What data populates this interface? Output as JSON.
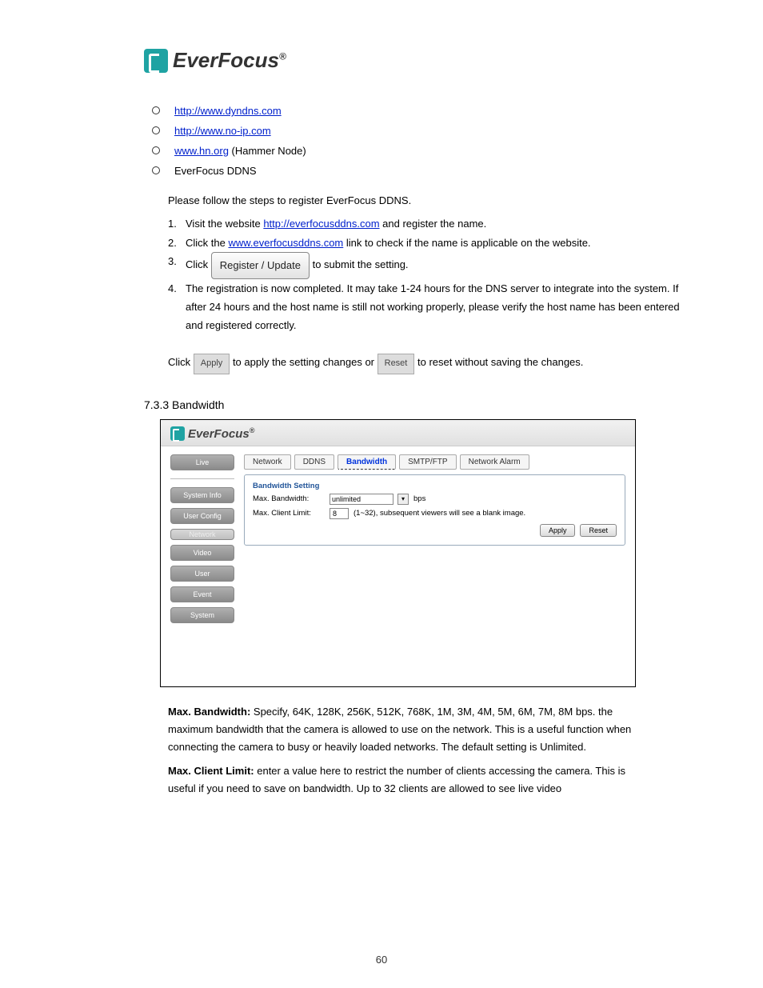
{
  "logo": {
    "brand": "EverFocus",
    "reg": "®"
  },
  "bullets": [
    {
      "link": "http://www.dyndns.com",
      "tail": " "
    },
    {
      "link": "http://www.no-ip.com",
      "tail": " "
    },
    {
      "link": "www.hn.org",
      "tail": " (Hammer Node)"
    },
    {
      "link": "",
      "tail": "EverFocus DDNS"
    }
  ],
  "instr": {
    "title": "Please follow the steps to register EverFocus DDNS.",
    "s1_n": "1.",
    "s1_txt_a": "Visit the website ",
    "s1_link": "http://everfocusddns.com",
    "s1_txt_b": " and register the name.",
    "s2_n": "2.",
    "s2_txt_a": "Click the ",
    "s2_link": "www.everfocusddns.com",
    "s2_txt_b": " link to check if the name is applicable on the website.",
    "s3_n": "3.",
    "s3_txt_a": "Click ",
    "s3_txt_b": " to submit the setting.",
    "reg_btn": "Register / Update",
    "s4_n": "4.",
    "s4_txt": "The registration is now completed. It may take 1-24 hours for the DNS server to integrate into the system. If after 24 hours and the host name is still not working properly, please verify the host name has been entered and registered correctly.",
    "apply_lead": "Click ",
    "apply_btn": "Apply",
    "apply_tail": " to apply the setting changes or ",
    "reset_btn": "Reset",
    "reset_tail": " to reset without saving the changes."
  },
  "section": "7.3.3 Bandwidth",
  "shot": {
    "brand": "EverFocus",
    "reg": "®",
    "side": [
      "Live",
      "System Info",
      "User Config",
      "Network",
      "Video",
      "User",
      "Event",
      "System"
    ],
    "tabs": [
      "Network",
      "DDNS",
      "Bandwidth",
      "SMTP/FTP",
      "Network Alarm"
    ],
    "active_tab_index": 2,
    "legend": "Bandwidth Setting",
    "row1_label": "Max. Bandwidth:",
    "row1_value": "unlimited",
    "row1_unit": "bps",
    "row2_label": "Max. Client Limit:",
    "row2_value": "8",
    "row2_hint": "(1~32), subsequent viewers will see a blank image.",
    "apply": "Apply",
    "reset": "Reset"
  },
  "desc": {
    "r1_label": "Max. Bandwidth:",
    "r1_txt": " Specify, 64K, 128K, 256K, 512K, 768K, 1M, 3M, 4M, 5M, 6M, 7M, 8M bps. the maximum bandwidth that the camera is allowed to use on the network. This is a useful function when connecting the camera to busy or heavily loaded networks. The default setting is Unlimited.",
    "r2_label": "Max. Client Limit:",
    "r2_txt": " enter a value here to restrict the number of clients accessing the camera. This is useful if you need to save on bandwidth. Up to 32 clients are allowed to see live video"
  },
  "page_number": "60"
}
